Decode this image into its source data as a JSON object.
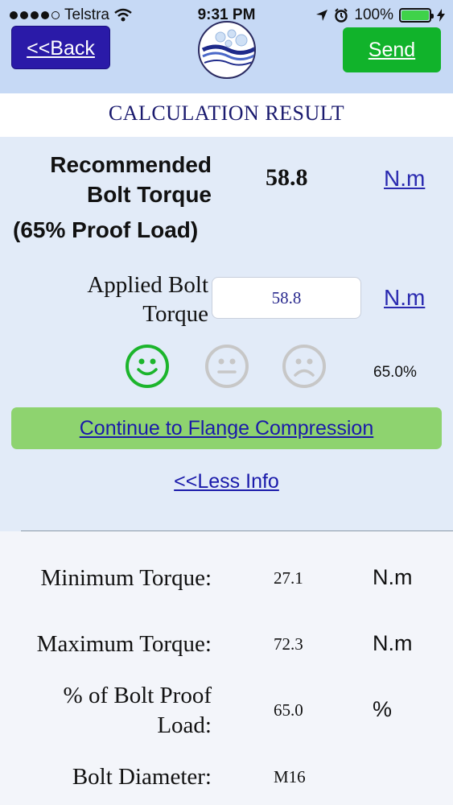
{
  "status_bar": {
    "carrier": "Telstra",
    "time": "9:31 PM",
    "battery": "100%"
  },
  "nav": {
    "back_label": "<<Back",
    "send_label": "Send"
  },
  "header": {
    "title": "CALCULATION RESULT"
  },
  "result": {
    "recommended_label_line1": "Recommended",
    "recommended_label_line2": "Bolt Torque",
    "recommended_sub": "(65% Proof Load)",
    "recommended_value": "58.8",
    "recommended_unit": "N.m",
    "applied_label_line1": "Applied Bolt",
    "applied_label_line2": "Torque",
    "applied_value": "58.8",
    "applied_unit": "N.m",
    "percent": "65.0%",
    "continue_label": "Continue to Flange Compression",
    "less_info_label": "<<Less Info"
  },
  "details": {
    "min_label": "Minimum Torque:",
    "min_value": "27.1",
    "min_unit": "N.m",
    "max_label": "Maximum Torque:",
    "max_value": "72.3",
    "max_unit": "N.m",
    "proof_label_line1": "% of Bolt Proof",
    "proof_label_line2": "Load:",
    "proof_value": "65.0",
    "proof_unit": "%",
    "diameter_label": "Bolt Diameter:",
    "diameter_value": "M16"
  },
  "colors": {
    "status_bg": "#c6d9f5",
    "back_button": "#2a1aa8",
    "send_button": "#11b32b",
    "continue_button": "#8ed36f",
    "good_face": "#1cb52c",
    "inactive_face": "#c7c7c7",
    "link": "#1a1aaa"
  },
  "icons": {
    "signal": "signal-dots-icon",
    "wifi": "wifi-icon",
    "location": "location-arrow-icon",
    "alarm": "alarm-clock-icon",
    "battery": "battery-icon",
    "charging": "charging-bolt-icon",
    "logo": "app-logo-icon",
    "good": "smiley-face-icon",
    "neutral": "neutral-face-icon",
    "bad": "sad-face-icon"
  }
}
